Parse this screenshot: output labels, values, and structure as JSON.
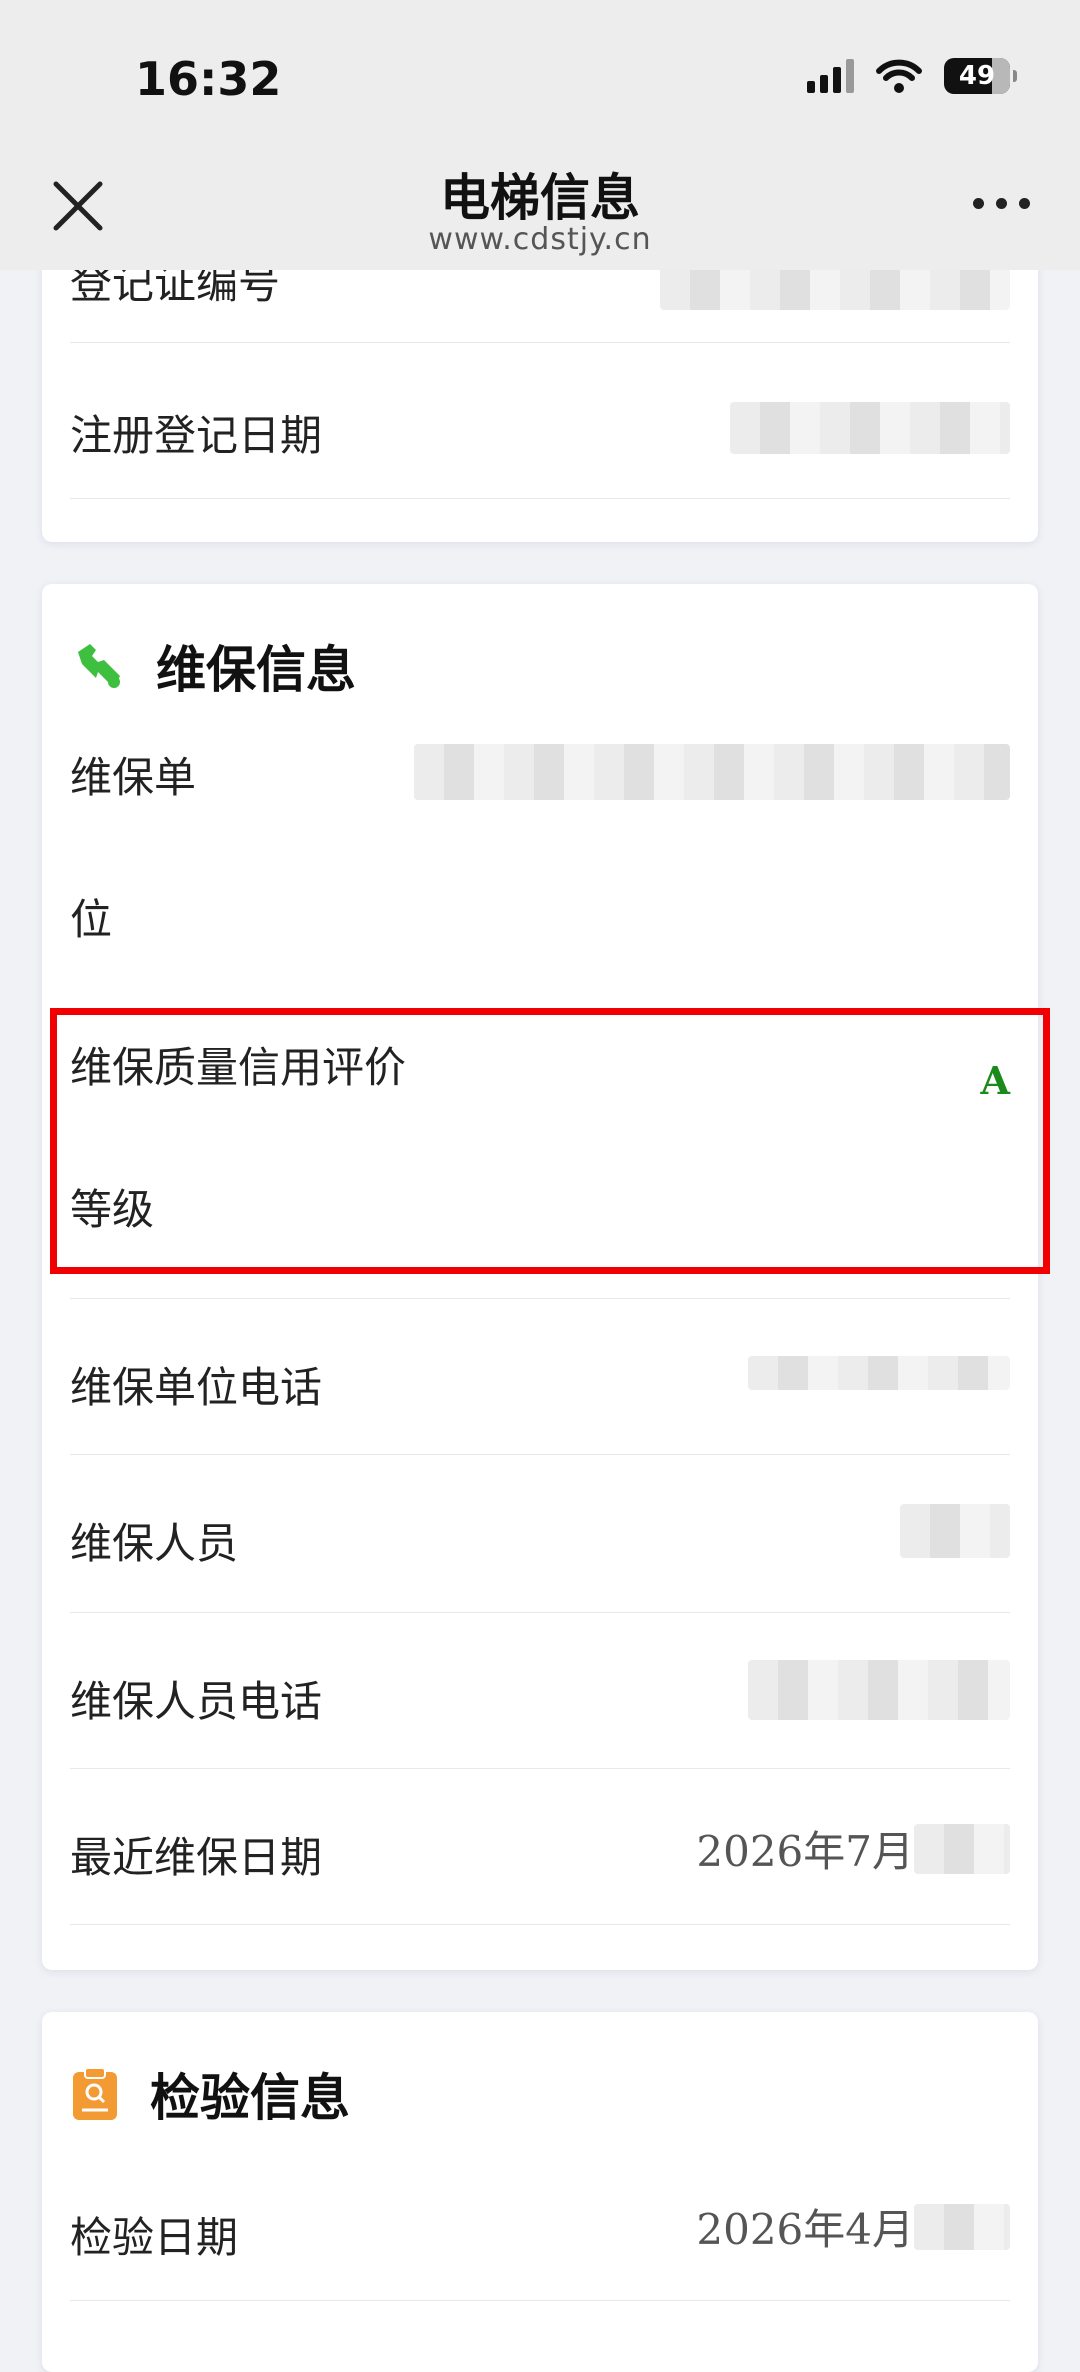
{
  "status_bar": {
    "time": "16:32",
    "battery": "49"
  },
  "nav": {
    "title": "电梯信息",
    "subtitle": "www.cdstjy.cn"
  },
  "registration_card": {
    "rows": [
      {
        "label": "登记证编号"
      },
      {
        "label": "注册登记日期"
      }
    ]
  },
  "maintenance": {
    "title": "维保信息",
    "icon": "wrench-icon",
    "unit_label_line1": "维保单",
    "unit_label_line2": "位",
    "credit_label_line1": "维保质量信用评价",
    "credit_label_line2": "等级",
    "credit_grade": "A",
    "grade_color": "#1a8a1a",
    "unit_phone_label": "维保单位电话",
    "person_label": "维保人员",
    "person_phone_label": "维保人员电话",
    "last_date_label": "最近维保日期",
    "last_date_value": "2026年7月"
  },
  "inspection": {
    "title": "检验信息",
    "icon": "inspection-report-icon",
    "date_label": "检验日期",
    "date_value": "2026年4月"
  },
  "highlight_color": "#f00000"
}
